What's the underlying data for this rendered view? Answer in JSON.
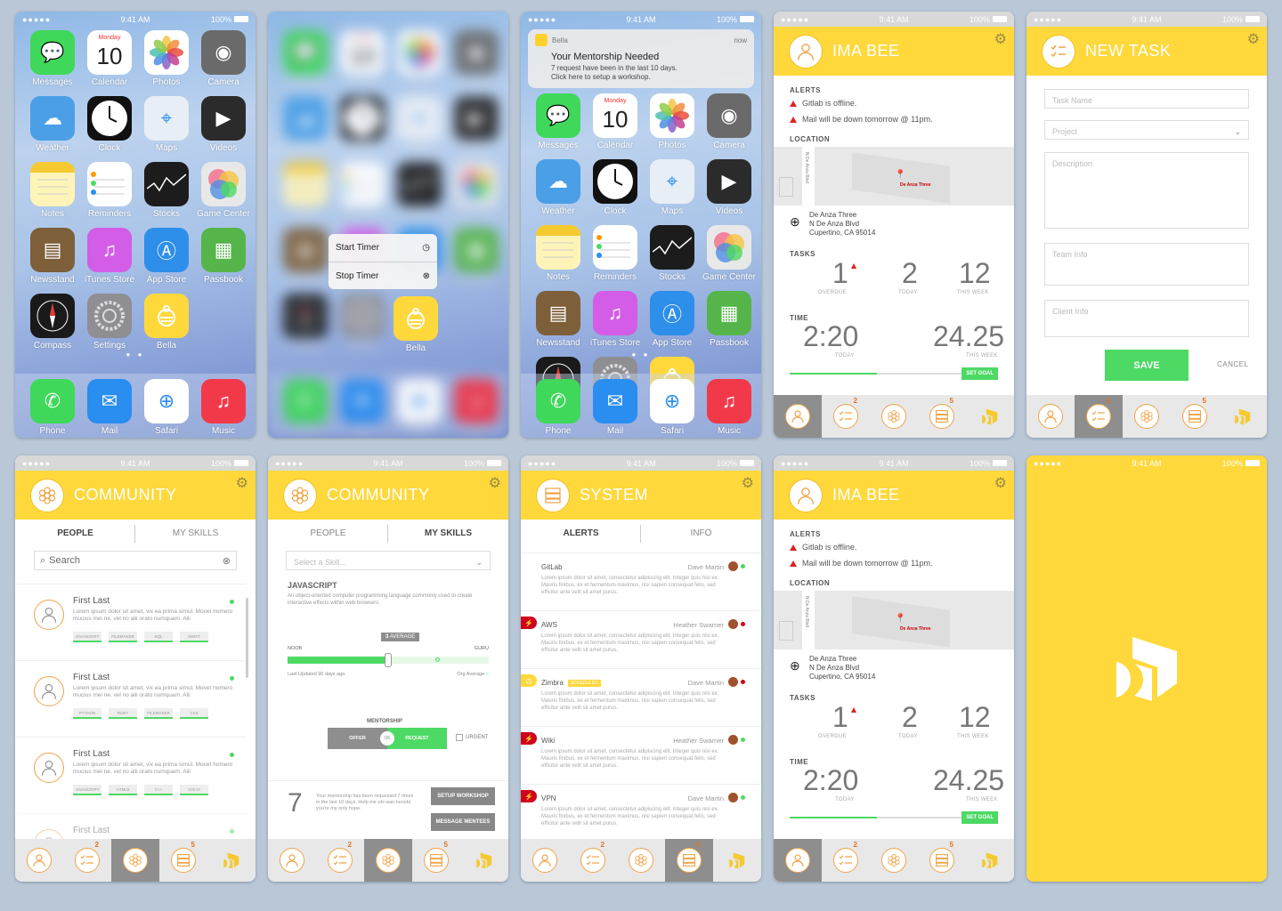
{
  "status": {
    "time": "9:41 AM",
    "battery": "100%",
    "signal": "●●●●●"
  },
  "apps": [
    {
      "name": "Messages",
      "color": "#3fd85a"
    },
    {
      "name": "Calendar",
      "color": "#ffffff"
    },
    {
      "name": "Photos",
      "color": "#ffffff"
    },
    {
      "name": "Camera",
      "color": "#6a6a6a"
    },
    {
      "name": "Weather",
      "color": "#4a9fe6"
    },
    {
      "name": "Clock",
      "color": "#111111"
    },
    {
      "name": "Maps",
      "color": "#e8eef5"
    },
    {
      "name": "Videos",
      "color": "#2b2b2b"
    },
    {
      "name": "Notes",
      "color": "#fff4b8"
    },
    {
      "name": "Reminders",
      "color": "#ffffff"
    },
    {
      "name": "Stocks",
      "color": "#1c1c1c"
    },
    {
      "name": "Game Center",
      "color": "#e8e8e8"
    },
    {
      "name": "Newsstand",
      "color": "#7d5f3a"
    },
    {
      "name": "iTunes Store",
      "color": "#d35de6"
    },
    {
      "name": "App Store",
      "color": "#2d8fe9"
    },
    {
      "name": "Passbook",
      "color": "#56b54a"
    },
    {
      "name": "Compass",
      "color": "#1a1a1a"
    },
    {
      "name": "Settings",
      "color": "#8e8e93"
    },
    {
      "name": "Bella",
      "color": "#ffd83c"
    }
  ],
  "calendar": {
    "day": "Monday",
    "date": "10"
  },
  "dock": [
    {
      "name": "Phone",
      "color": "#3fd85a"
    },
    {
      "name": "Mail",
      "color": "#2a8df0"
    },
    {
      "name": "Safari",
      "color": "#ffffff"
    },
    {
      "name": "Music",
      "color": "#f2394a"
    }
  ],
  "quick_actions": {
    "start": "Start Timer",
    "stop": "Stop Timer"
  },
  "notification": {
    "app": "Bella",
    "when": "now",
    "title": "Your Mentorship Needed",
    "line1": "7 request have been in the last 10 days.",
    "line2": "Click here to setup a workshop."
  },
  "profile": {
    "name": "IMA BEE",
    "alerts_label": "ALERTS",
    "alerts": [
      "Gitlab is offline.",
      "Mail will be down tomorrow @ 11pm."
    ],
    "location_label": "LOCATION",
    "map_street": "N De Anza Blvd",
    "map_pin": "De Anza Three",
    "address": [
      "De Anza Three",
      "N De Anza Blvd",
      "Cupertino, CA 95014"
    ],
    "tasks_label": "TASKS",
    "overdue": "1",
    "overdue_label": "OVERDUE",
    "today": "2",
    "today_label": "TODAY",
    "week": "12",
    "week_label": "THIS WEEK",
    "time_label": "TIME",
    "time_today": "2:20",
    "time_today_label": "TODAY",
    "time_week": "24.25",
    "time_week_label": "THIS WEEK",
    "goal_button": "SET GOAL",
    "progress": 0.42
  },
  "new_task": {
    "title": "NEW TASK",
    "task_name": "Task Name",
    "project": "Project",
    "description": "Description",
    "team": "Team Info",
    "client": "Client Info",
    "save": "SAVE",
    "cancel": "CANCEL"
  },
  "community": {
    "title": "COMMUNITY",
    "tab_people": "PEOPLE",
    "tab_skills": "MY SKILLS",
    "search": "Search",
    "people": [
      {
        "name": "First Last",
        "desc": "Lorem ipsum dolor sit amet, vix ea prima simul. Movet homero mucius mei ne, vel no alii orato numquam. Alii",
        "skills": [
          "JAVASCRIPT",
          "FILEMAKER",
          "SQL",
          "SWIFT"
        ]
      },
      {
        "name": "First Last",
        "desc": "Lorem ipsum dolor sit amet, vix ea prima simul. Movet homero mucius mei ne, vel no alii orato numquam. Alii",
        "skills": [
          "PYTHON",
          "RUBY",
          "FILEMAKER",
          "CSS"
        ]
      },
      {
        "name": "First Last",
        "desc": "Lorem ipsum dolor sit amet, vix ea prima simul. Movet homero mucius mei ne, vel no alii orato numquam. Alii",
        "skills": [
          "JAVASCRIPT",
          "HTML5",
          "C++",
          "IOS UI"
        ]
      },
      {
        "name": "First Last"
      }
    ]
  },
  "skills": {
    "select": "Select a Skill...",
    "skill": "JAVASCRIPT",
    "skill_desc": "An object-oriented computer programming language commonly used to create interactive effects within web browsers.",
    "noob": "NOOB",
    "guru": "GURU",
    "avg_badge": "3",
    "avg_label": "AVERAGE",
    "updated": "Last Updated 90 days ago.",
    "org_avg": "Org Average",
    "level": 0.5,
    "mentorship": "MENTORSHIP",
    "offer": "OFFER",
    "ok": "OK",
    "request": "REQUEST",
    "urgent": "URGENT",
    "count": "7",
    "count_text": "Your mentorship has been requested 7 times in the last 10 days. Help me obi wan kenobi you're my only hope.",
    "setup": "SETUP WORKSHOP",
    "message": "MESSAGE MENTEES"
  },
  "system": {
    "title": "SYSTEM",
    "tab_alerts": "ALERTS",
    "tab_info": "INFO",
    "desc": "Lorem ipsum dolor sit amet, consectetur adipiscing elit. Integer quis nisi ex. Mauris finibus, ex et fermentum maximus, nisi sapien consequat felis, sed efficitur ante velit sit amet purus.",
    "rows": [
      {
        "name": "GitLab",
        "who": "Dave Martin",
        "status": "#4cd964",
        "flag": ""
      },
      {
        "name": "AWS",
        "who": "Heather Swarner",
        "status": "#d0021b",
        "flag": "#d0021b"
      },
      {
        "name": "Zimbra",
        "badge": "SCHEDULED",
        "who": "Dave Martin",
        "status": "#d0021b",
        "flag": "#ffd83c"
      },
      {
        "name": "Wiki",
        "who": "Heather Swarner",
        "status": "#4cd964",
        "flag": "#d0021b"
      },
      {
        "name": "VPN",
        "who": "Dave Martin",
        "status": "#4cd964",
        "flag": "#d0021b"
      }
    ]
  },
  "tabbar": {
    "badge_tasks": "2",
    "badge_system": "5"
  },
  "colors": {
    "accent": "#ffd83c",
    "orange": "#f0a44a",
    "green": "#4cd964",
    "red": "#d0021b"
  }
}
